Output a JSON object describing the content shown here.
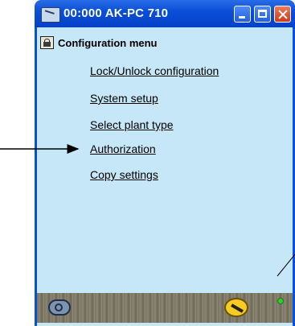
{
  "window": {
    "title": "00:000 AK-PC 710",
    "icons": {
      "app": "computer-icon",
      "minimize": "minimize-icon",
      "maximize": "maximize-icon",
      "close": "close-icon"
    }
  },
  "menu": {
    "title": "Configuration menu",
    "icon": "lock-icon",
    "items": [
      {
        "label": "Lock/Unlock configuration"
      },
      {
        "label": "System setup"
      },
      {
        "label": "Select plant type"
      },
      {
        "label": "Authorization"
      },
      {
        "label": "Copy settings"
      }
    ]
  },
  "statusbar": {
    "icons": [
      "user-icon",
      "wrench-icon",
      "status-led-icon"
    ],
    "led_color": "#2bd12b"
  },
  "colors": {
    "titlebar": "#0a4fd8",
    "client_bg": "#c5e7f7",
    "close_button": "#cc3b1c"
  }
}
